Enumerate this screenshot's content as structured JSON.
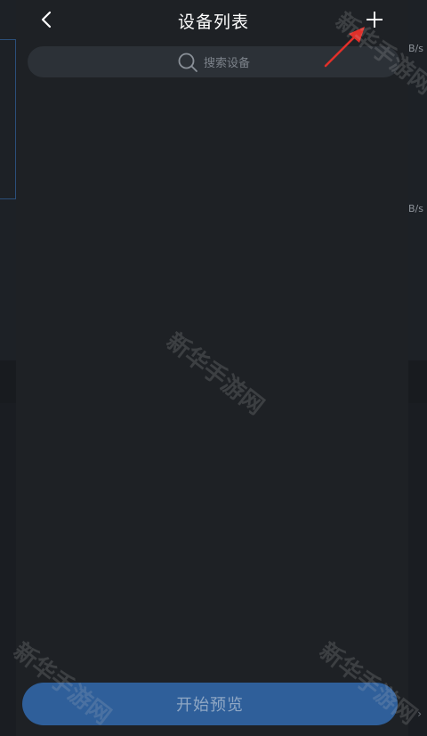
{
  "header": {
    "title": "设备列表",
    "back_icon": "chevron-left-icon",
    "add_icon": "plus-icon"
  },
  "search": {
    "placeholder": "搜索设备",
    "icon": "search-icon"
  },
  "footer": {
    "start_preview_label": "开始预览"
  },
  "background": {
    "speed_label_1": "B/s",
    "speed_label_2": "B/s",
    "chevron": "›"
  },
  "watermark": {
    "text": "新华手游网"
  },
  "colors": {
    "drawer_bg": "#1e2125",
    "search_bg": "#2c3137",
    "primary_button": "#2f5f9a",
    "annotation_arrow": "#e0302a"
  }
}
